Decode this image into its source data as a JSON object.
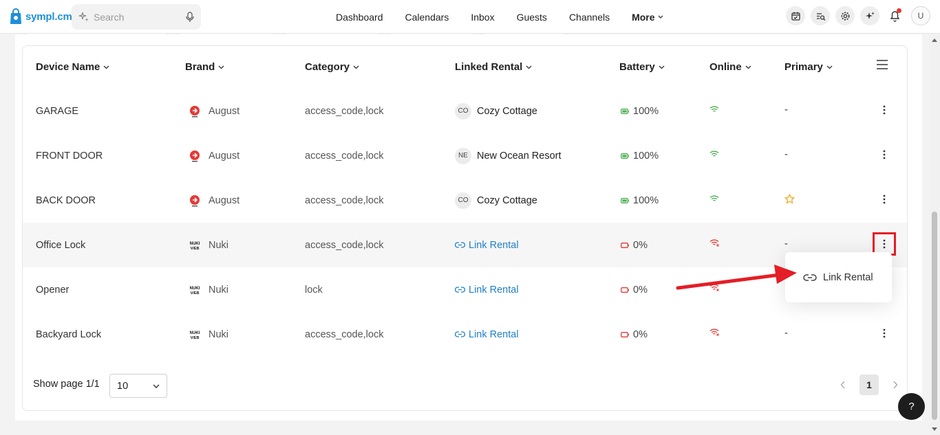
{
  "app": {
    "logo_text": "sympl.cm"
  },
  "search": {
    "placeholder": "Search"
  },
  "nav": {
    "items": [
      "Dashboard",
      "Calendars",
      "Inbox",
      "Guests",
      "Channels"
    ],
    "more_label": "More"
  },
  "top_icons": [
    "calendar-check-icon",
    "search-list-icon",
    "settings-gear-icon",
    "sparkle-icon",
    "bell-icon"
  ],
  "user": {
    "avatar_initial": "U"
  },
  "table": {
    "headers": {
      "device_name": "Device Name",
      "brand": "Brand",
      "category": "Category",
      "linked_rental": "Linked Rental",
      "battery": "Battery",
      "online": "Online",
      "primary": "Primary"
    },
    "rows": [
      {
        "device": "GARAGE",
        "brand": "August",
        "category": "access_code,lock",
        "rental_badge": "CO",
        "rental": "Cozy Cottage",
        "battery": "100%",
        "battery_status": "ok",
        "online": true,
        "primary": "-"
      },
      {
        "device": "FRONT DOOR",
        "brand": "August",
        "category": "access_code,lock",
        "rental_badge": "NE",
        "rental": "New Ocean Resort",
        "battery": "100%",
        "battery_status": "ok",
        "online": true,
        "primary": "-"
      },
      {
        "device": "BACK DOOR",
        "brand": "August",
        "category": "access_code,lock",
        "rental_badge": "CO",
        "rental": "Cozy Cottage",
        "battery": "100%",
        "battery_status": "ok",
        "online": true,
        "primary": "star"
      },
      {
        "device": "Office Lock",
        "brand": "Nuki",
        "category": "access_code,lock",
        "rental_badge": "",
        "rental": "Link Rental",
        "battery": "0%",
        "battery_status": "empty",
        "online": false,
        "primary": "-"
      },
      {
        "device": "Opener",
        "brand": "Nuki",
        "category": "lock",
        "rental_badge": "",
        "rental": "Link Rental",
        "battery": "0%",
        "battery_status": "empty",
        "online": false,
        "primary": ""
      },
      {
        "device": "Backyard Lock",
        "brand": "Nuki",
        "category": "access_code,lock",
        "rental_badge": "",
        "rental": "Link Rental",
        "battery": "0%",
        "battery_status": "empty",
        "online": false,
        "primary": "-"
      }
    ]
  },
  "pagination": {
    "label": "Show page 1/1",
    "page_size": "10",
    "current_page": "1"
  },
  "popover": {
    "label": "Link Rental"
  },
  "help": {
    "label": "?"
  },
  "colors": {
    "accent": "#1f7fc9",
    "battery_ok": "#4caf50",
    "battery_empty": "#e53935",
    "online": "#4caf50",
    "offline": "#e53935",
    "star": "#f5a623",
    "highlight_box": "#e41e26"
  }
}
